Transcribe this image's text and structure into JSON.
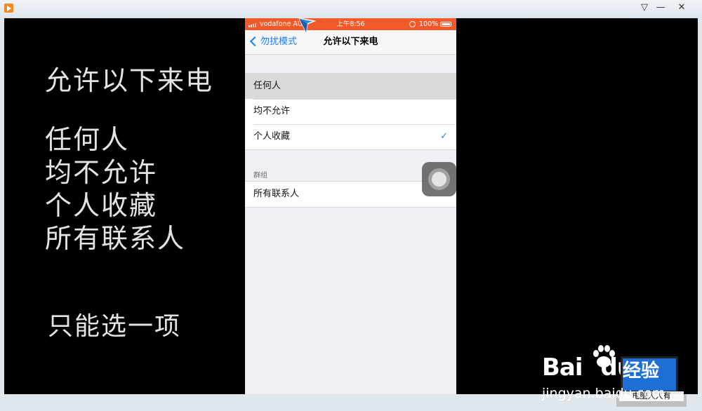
{
  "window": {
    "icons": {
      "app": "play-icon",
      "dropdown": "chevron-down-icon",
      "minimize": "minimize-icon",
      "close": "close-icon"
    },
    "glyphs": {
      "dropdown": "▽",
      "minimize": "—",
      "close": "✕"
    }
  },
  "overlay": {
    "title": "允许以下来电",
    "options": [
      "任何人",
      "均不允许",
      "个人收藏",
      "所有联系人"
    ],
    "note": "只能选一项",
    "color": "#e3e3e3"
  },
  "phone": {
    "status": {
      "carrier": "vodafone AU",
      "time": "上午8:56",
      "battery": "100%",
      "bar_color": "#f4592a"
    },
    "nav": {
      "back_label": "勿扰模式",
      "title": "允许以下来电",
      "accent": "#1a7cf6"
    },
    "options": [
      {
        "label": "任何人",
        "highlighted": true,
        "checked": false
      },
      {
        "label": "均不允许",
        "highlighted": false,
        "checked": false
      },
      {
        "label": "个人收藏",
        "highlighted": false,
        "checked": true
      }
    ],
    "groups_header": "群组",
    "groups": [
      {
        "label": "所有联系人"
      }
    ],
    "checkmark": "✓"
  },
  "watermark": {
    "brand": "Bai",
    "brand_suffix": "du",
    "product": "经验",
    "url": "jingyan.baidu.com",
    "laptop_caption": "电脑人人有"
  }
}
